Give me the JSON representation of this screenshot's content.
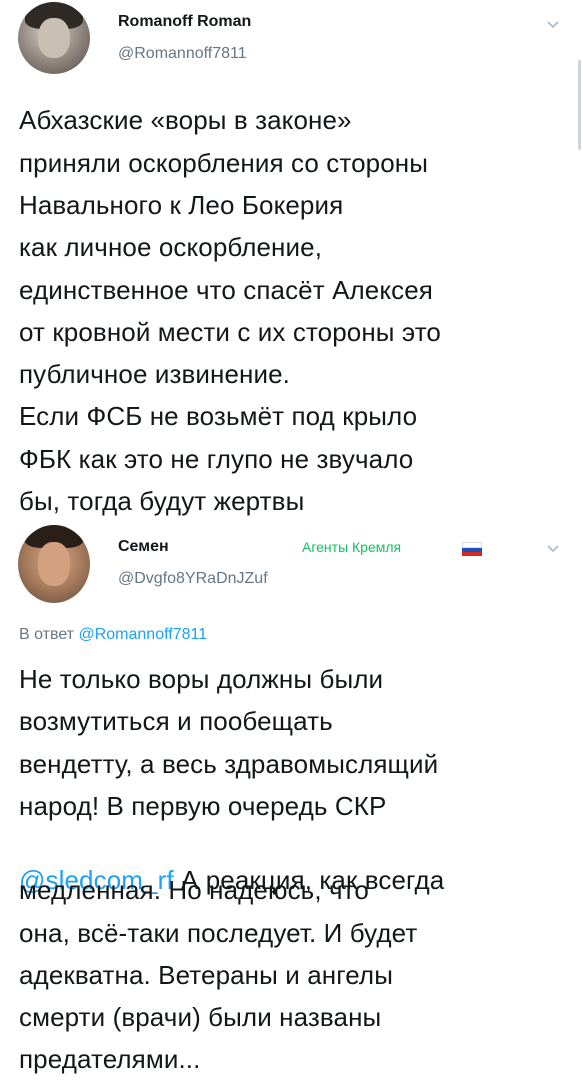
{
  "tweet": {
    "author_name": "Romanoff Roman",
    "author_handle": "@Romannoff7811",
    "lines": [
      "Абхазские «воры в законе»",
      "приняли оскорбления со стороны",
      "Навального к Лео Бокерия",
      "как личное оскорбление,",
      "единственное что спасёт Алексея",
      "от кровной мести с их стороны это",
      "публичное извинение.",
      "Если ФСБ не возьмёт под крыло",
      "ФБК как это не глупо не звучало",
      "бы, тогда будут жертвы"
    ]
  },
  "reply": {
    "author_name": "Семен",
    "author_handle": "@Dvgfo8YRaDnJZuf",
    "badge_text": "Агенты Кремля",
    "reply_to_prefix": "В ответ",
    "reply_to_handle": "@Romannoff7811",
    "line1": "Не только воры должны были",
    "line2": "возмутиться и пообещать",
    "line3": "вендетту, а весь здравомыслящий",
    "line4": "народ! В первую очередь СКР",
    "line5_mention": "@sledcom_rf",
    "line5_rest": "  А реакция, как всегда",
    "line6": "медленная. Но надеюсь, что",
    "line7": "она, всё-таки последует. И будет",
    "line8": "адекватна. Ветераны и ангелы",
    "line9": "смерти (врачи) были названы",
    "line10": "предателями..."
  },
  "icons": {
    "menu": "chevron-down-icon",
    "flag": "russian-flag-icon"
  },
  "colors": {
    "link": "#1da1f2",
    "muted": "#657786",
    "badge": "#17bf63"
  }
}
